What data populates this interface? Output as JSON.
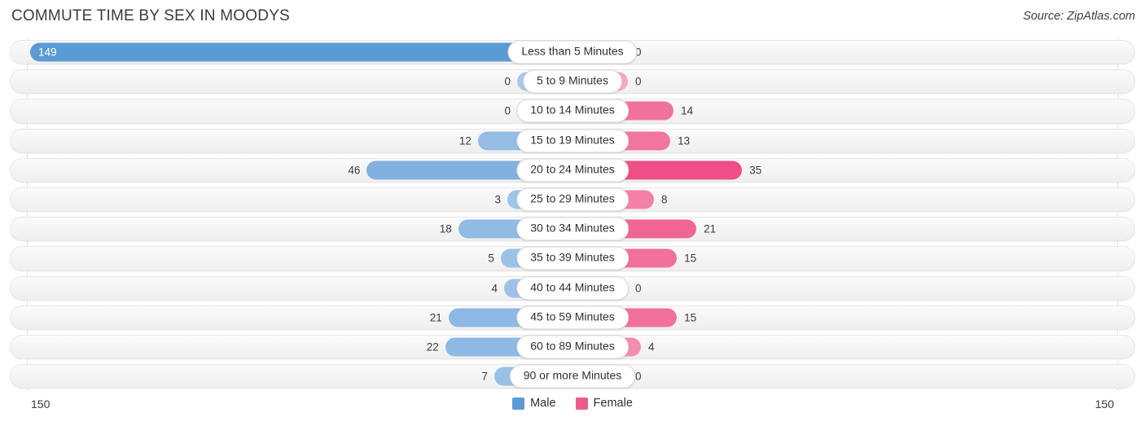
{
  "header": {
    "title": "COMMUTE TIME BY SEX IN MOODYS",
    "source": "Source: ZipAtlas.com"
  },
  "footer": {
    "axis_left": "150",
    "axis_right": "150"
  },
  "legend": {
    "items": [
      {
        "label": "Male",
        "color": "#5b9bd5"
      },
      {
        "label": "Female",
        "color": "#ef5a8c"
      }
    ]
  },
  "colors": {
    "male_max": "#5b9bd5",
    "male_min": "#a8c9ec",
    "female_max": "#ef4f86",
    "female_min": "#f7a8c4",
    "track": "#f4f4f4",
    "text": "#3a3a45"
  },
  "chart_data": {
    "type": "bar",
    "title": "COMMUTE TIME BY SEX IN MOODYS",
    "subtitle": "Source: ZipAtlas.com",
    "orientation": "horizontal-diverging",
    "xlabel": "",
    "ylabel": "",
    "xlim": [
      0,
      150
    ],
    "axis_max": 150,
    "grid": true,
    "legend_position": "bottom-center",
    "categories": [
      "Less than 5 Minutes",
      "5 to 9 Minutes",
      "10 to 14 Minutes",
      "15 to 19 Minutes",
      "20 to 24 Minutes",
      "25 to 29 Minutes",
      "30 to 34 Minutes",
      "35 to 39 Minutes",
      "40 to 44 Minutes",
      "45 to 59 Minutes",
      "60 to 89 Minutes",
      "90 or more Minutes"
    ],
    "series": [
      {
        "name": "Male",
        "side": "left",
        "values": [
          149,
          0,
          0,
          12,
          46,
          3,
          18,
          5,
          4,
          21,
          22,
          7
        ]
      },
      {
        "name": "Female",
        "side": "right",
        "values": [
          0,
          0,
          14,
          13,
          35,
          8,
          21,
          15,
          0,
          15,
          4,
          0
        ]
      }
    ]
  }
}
